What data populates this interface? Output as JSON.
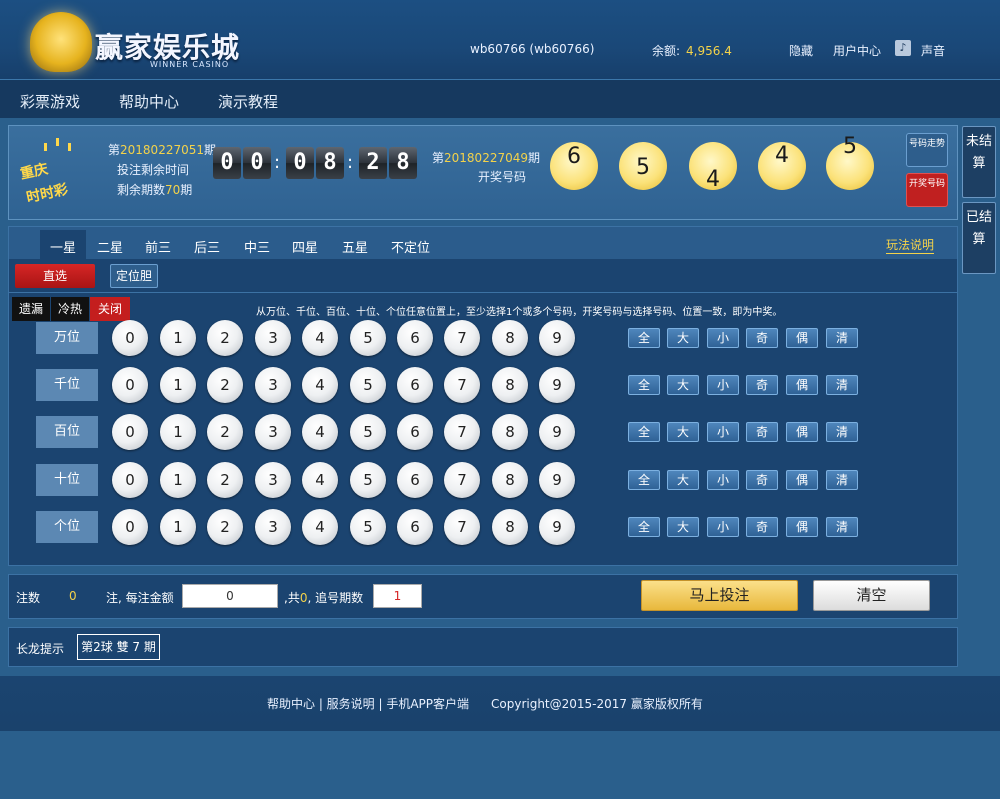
{
  "header": {
    "logo_text": "赢家娱乐城",
    "logo_sub": "WINNER CASINO",
    "user": "wb60766 (wb60766)",
    "balance_label": "余额:",
    "balance_value": "4,956.4",
    "hide": "隐藏",
    "user_center": "用户中心",
    "sound": "声音"
  },
  "nav": [
    "彩票游戏",
    "帮助中心",
    "演示教程"
  ],
  "draw": {
    "badge_line1": "重庆",
    "badge_line2": "时时彩",
    "cur_prefix": "第",
    "cur_period": "20180227051",
    "period_suffix": "期",
    "remaining_time": "投注剩余时间",
    "remaining_count_label": "剩余期数",
    "remaining_count": "70",
    "countdown": [
      "0",
      "0",
      "0",
      "8",
      "2",
      "8"
    ],
    "last_prefix": "第",
    "last_period": "20180227049",
    "draw_numbers_label": "开奖号码",
    "numbers": [
      "6",
      "5",
      "4",
      "4",
      "5"
    ],
    "trend_button": "号码走势",
    "draw_button": "开奖号码"
  },
  "side_tabs": [
    "未结算",
    "已结算"
  ],
  "play": {
    "tabs": [
      "一星",
      "二星",
      "前三",
      "后三",
      "中三",
      "四星",
      "五星",
      "不定位"
    ],
    "active_tab": "一星",
    "rules": "玩法说明",
    "direct": "直选",
    "pos_dan": "定位胆",
    "options": [
      "遗漏",
      "冷热",
      "关闭"
    ],
    "hint": "从万位、千位、百位、十位、个位任意位置上，至少选择1个或多个号码，开奖号码与选择号码、位置一致，即为中奖。",
    "positions": [
      "万位",
      "千位",
      "百位",
      "十位",
      "个位"
    ],
    "numbers": [
      "0",
      "1",
      "2",
      "3",
      "4",
      "5",
      "6",
      "7",
      "8",
      "9"
    ],
    "quick": [
      "全",
      "大",
      "小",
      "奇",
      "偶",
      "清"
    ]
  },
  "bet": {
    "count_label": "注数",
    "count": "0",
    "amount_label": "注, 每注金额",
    "amount": "0",
    "total_prefix": ",共",
    "total": "0",
    "chase_label": ", 追号期数",
    "chase": "1",
    "submit": "马上投注",
    "clear": "清空"
  },
  "dragon": {
    "label": "长龙提示",
    "item": "第2球 雙 7 期"
  },
  "footer": {
    "links": "帮助中心 | 服务说明 | 手机APP客户端",
    "copyright": "Copyright@2015-2017 赢家版权所有"
  }
}
